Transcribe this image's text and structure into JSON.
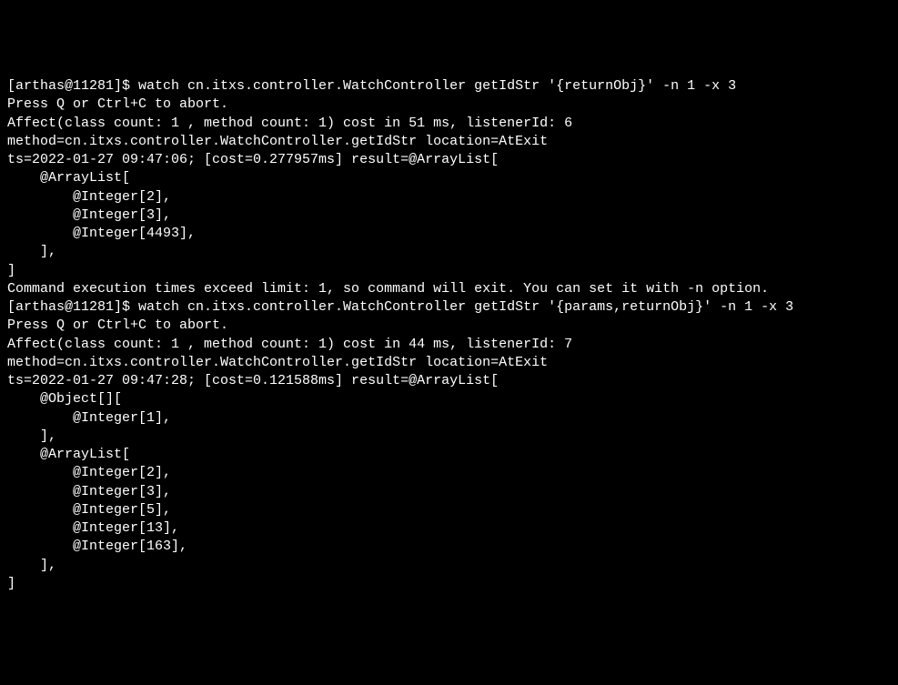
{
  "terminal": {
    "lines": [
      "[arthas@11281]$ watch cn.itxs.controller.WatchController getIdStr '{returnObj}' -n 1 -x 3",
      "Press Q or Ctrl+C to abort.",
      "Affect(class count: 1 , method count: 1) cost in 51 ms, listenerId: 6",
      "method=cn.itxs.controller.WatchController.getIdStr location=AtExit",
      "ts=2022-01-27 09:47:06; [cost=0.277957ms] result=@ArrayList[",
      "    @ArrayList[",
      "        @Integer[2],",
      "        @Integer[3],",
      "        @Integer[4493],",
      "    ],",
      "]",
      "Command execution times exceed limit: 1, so command will exit. You can set it with -n option.",
      "[arthas@11281]$ watch cn.itxs.controller.WatchController getIdStr '{params,returnObj}' -n 1 -x 3",
      "Press Q or Ctrl+C to abort.",
      "Affect(class count: 1 , method count: 1) cost in 44 ms, listenerId: 7",
      "method=cn.itxs.controller.WatchController.getIdStr location=AtExit",
      "ts=2022-01-27 09:47:28; [cost=0.121588ms] result=@ArrayList[",
      "    @Object[][",
      "        @Integer[1],",
      "    ],",
      "    @ArrayList[",
      "        @Integer[2],",
      "        @Integer[3],",
      "        @Integer[5],",
      "        @Integer[13],",
      "        @Integer[163],",
      "    ],",
      "]"
    ]
  }
}
